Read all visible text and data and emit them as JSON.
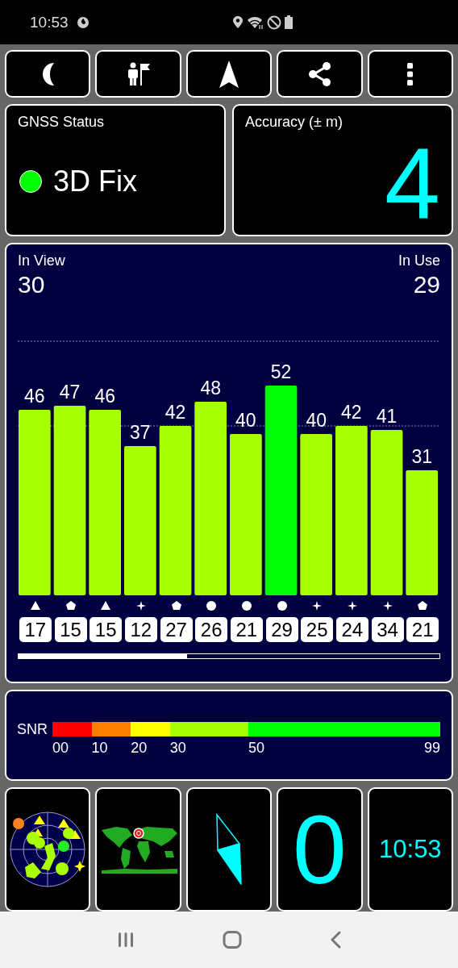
{
  "status_bar": {
    "time": "10:53"
  },
  "toolbar": [
    {
      "kind": "moon"
    },
    {
      "kind": "person-flag"
    },
    {
      "kind": "navigation"
    },
    {
      "kind": "share"
    },
    {
      "kind": "more"
    }
  ],
  "gnss_status": {
    "title": "GNSS Status",
    "fix": "3D Fix",
    "color": "#00ff00"
  },
  "accuracy": {
    "title": "Accuracy (± m)",
    "value": "4"
  },
  "satellites": {
    "in_view_label": "In View",
    "in_view": "30",
    "in_use_label": "In Use",
    "in_use": "29",
    "chart_data": {
      "type": "bar",
      "categories": [
        "17",
        "15",
        "15",
        "12",
        "27",
        "26",
        "21",
        "29",
        "25",
        "24",
        "34",
        "21"
      ],
      "values": [
        46,
        47,
        46,
        37,
        42,
        48,
        40,
        52,
        40,
        42,
        41,
        31
      ],
      "data_labels": true
    },
    "constellations": [
      {
        "kind": "triangle"
      },
      {
        "kind": "pentagon"
      },
      {
        "kind": "triangle"
      },
      {
        "kind": "star"
      },
      {
        "kind": "pentagon"
      },
      {
        "kind": "circle"
      },
      {
        "kind": "circle"
      },
      {
        "kind": "circle"
      },
      {
        "kind": "star"
      },
      {
        "kind": "star"
      },
      {
        "kind": "star"
      },
      {
        "kind": "pentagon"
      }
    ]
  },
  "snr_scale": {
    "label": "SNR",
    "segments": [
      {
        "color": "#ff0000"
      },
      {
        "color": "#ff8000"
      },
      {
        "color": "#ffff00"
      },
      {
        "color": "#a8ff00"
      },
      {
        "color": "#00ff00"
      }
    ],
    "ticks": [
      "00",
      "10",
      "20",
      "30",
      "50",
      "99"
    ]
  },
  "tiles": [
    {
      "kind": "sky-plot"
    },
    {
      "kind": "world-map"
    },
    {
      "kind": "compass"
    },
    {
      "kind": "speed",
      "value": "0"
    },
    {
      "kind": "clock",
      "value": "10:53"
    }
  ]
}
